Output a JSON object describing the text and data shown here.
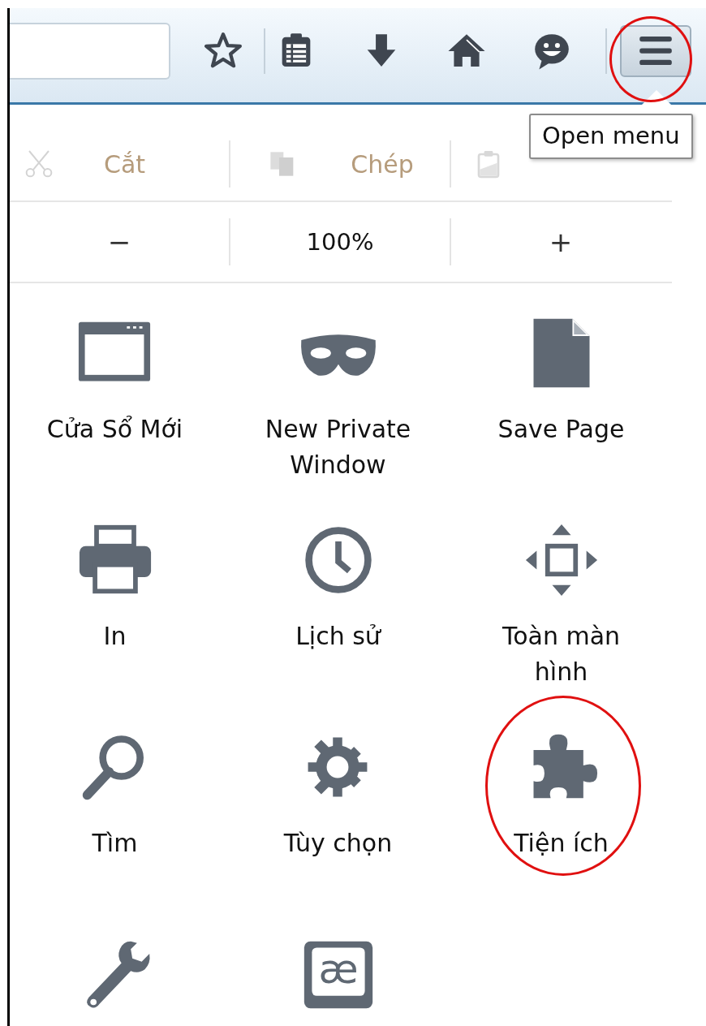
{
  "toolbar": {
    "buttons": [
      {
        "kind": "star"
      },
      {
        "kind": "reader"
      },
      {
        "kind": "download"
      },
      {
        "kind": "home"
      },
      {
        "kind": "chat"
      }
    ],
    "menu_button": {
      "circled": true,
      "tooltip": "Open menu"
    }
  },
  "edit_row": [
    {
      "kind": "cut",
      "label": "Cắt",
      "disabled": true
    },
    {
      "kind": "copy",
      "label": "Chép",
      "disabled": true
    },
    {
      "kind": "paste",
      "disabled": true
    }
  ],
  "zoom_row": {
    "zoom_out": "−",
    "zoom_level": "100%",
    "zoom_in": "+"
  },
  "items": [
    {
      "kind": "window",
      "label": "Cửa Sổ Mới",
      "circled": false
    },
    {
      "kind": "mask",
      "label": "New Private Window",
      "circled": false
    },
    {
      "kind": "page",
      "label": "Save Page",
      "circled": false
    },
    {
      "kind": "printer",
      "label": "In",
      "circled": false
    },
    {
      "kind": "clock",
      "label": "Lịch sử",
      "circled": false
    },
    {
      "kind": "fullscreen",
      "label": "Toàn màn hình",
      "circled": false
    },
    {
      "kind": "search",
      "label": "Tìm",
      "circled": false
    },
    {
      "kind": "gear",
      "label": "Tùy chọn",
      "circled": false
    },
    {
      "kind": "puzzle",
      "label": "Tiện ích",
      "circled": true
    },
    {
      "kind": "wrench",
      "circled": false
    },
    {
      "kind": "glyph",
      "glyph": "æ",
      "circled": false
    }
  ]
}
